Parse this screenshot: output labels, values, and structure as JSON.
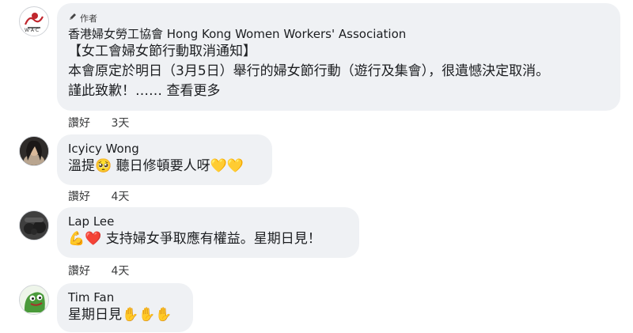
{
  "comments": [
    {
      "author_badge": "作者",
      "author": "香港婦女勞工協會 Hong Kong Women Workers' Association",
      "lines": [
        "【女工會婦女節行動取消通知】",
        "本會原定於明日（3月5日）舉行的婦女節行動（遊行及集會），很遺憾決定取消。"
      ],
      "last_line": "謹此致歉！……",
      "see_more": "查看更多",
      "like": "讚好",
      "time": "3天"
    },
    {
      "author": "Icyicy Wong",
      "text": "溫提🥺 聽日修頓要人呀💛💛",
      "like": "讚好",
      "time": "4天"
    },
    {
      "author": "Lap Lee",
      "text": "💪❤️ 支持婦女爭取應有權益。星期日見！",
      "like": "讚好",
      "time": "4天"
    },
    {
      "author": "Tim Fan",
      "text": "星期日見✋✋✋"
    }
  ],
  "colors": {
    "bubble": "#eff1f4",
    "text": "#1c1e21",
    "meta": "#3a3b3c"
  },
  "icons": [
    "pencil-icon",
    "association-logo",
    "avatar-icyicy",
    "avatar-lap",
    "avatar-tim"
  ]
}
